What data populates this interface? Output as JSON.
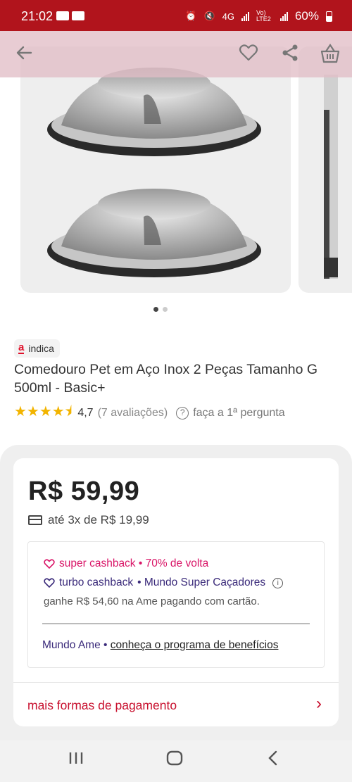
{
  "status_bar": {
    "time": "21:02",
    "network": "4G",
    "volte": "Vo) LTE2",
    "battery": "60%"
  },
  "product": {
    "badge": "indica",
    "badge_logo": "a",
    "title": "Comedouro Pet em Aço Inox 2 Peças Tamanho G 500ml - Basic+",
    "stars": "★★★★⯨",
    "rating": "4,7",
    "reviews": "(7 avaliações)",
    "ask": "faça a 1ª pergunta"
  },
  "price": {
    "value": "R$ 59,99",
    "installments": "até 3x de R$ 19,99"
  },
  "cashback": {
    "super": "super cashback • 70% de volta",
    "turbo_label": "turbo cashback",
    "turbo_program": "• Mundo Super Caçadores",
    "earn": "ganhe R$ 54,60 na Ame pagando com cartão.",
    "ame_prefix": "Mundo Ame •",
    "ame_link": "conheça o programa de benefícios"
  },
  "more_payment": "mais formas de pagamento",
  "icons": {
    "back": "back-arrow-icon",
    "favorite": "heart-icon",
    "share": "share-icon",
    "basket": "basket-icon"
  },
  "colors": {
    "brand": "#b1141c",
    "accent": "#c8102e",
    "cashback_pink": "#d91567",
    "ame_purple": "#3a2a7a",
    "star": "#f2b400"
  }
}
